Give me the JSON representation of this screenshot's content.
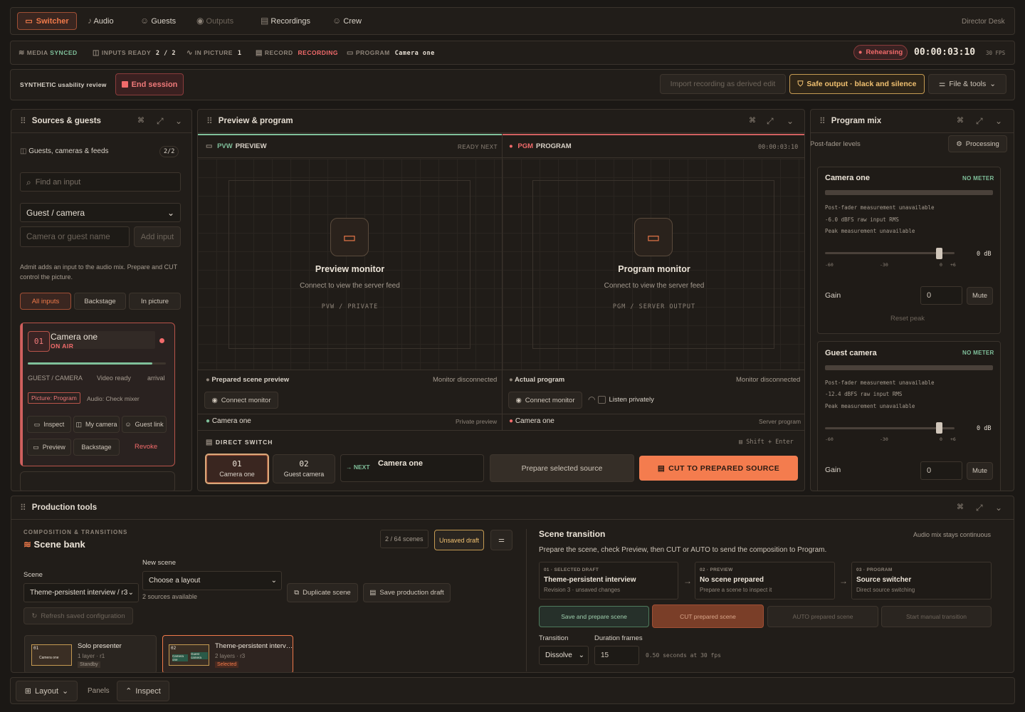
{
  "nav": {
    "tabs": [
      {
        "label": "Switcher",
        "icon": "switcher-icon"
      },
      {
        "label": "Audio",
        "icon": "mic-icon"
      },
      {
        "label": "Guests",
        "icon": "users-icon"
      },
      {
        "label": "Outputs",
        "icon": "broadcast-icon"
      },
      {
        "label": "Recordings",
        "icon": "drive-icon"
      },
      {
        "label": "Crew",
        "icon": "crew-icon"
      }
    ],
    "right": "Director Desk"
  },
  "status": {
    "media_label": "MEDIA",
    "media_value": "SYNCED",
    "inputs_label": "INPUTS READY",
    "inputs_value": "2 / 2",
    "inpicture_label": "IN PICTURE",
    "inpicture_value": "1",
    "record_label": "RECORD",
    "record_value": "RECORDING",
    "program_label": "PROGRAM",
    "program_value": "Camera one",
    "state": "Rehearsing",
    "timecode": "00:00:03:10",
    "fps": "30 FPS"
  },
  "session": {
    "label": "SYNTHETIC usability review",
    "end": "End session",
    "import": "Import recording as derived edit",
    "safe": "Safe output · black and silence",
    "file": "File & tools"
  },
  "sources": {
    "title": "Sources & guests",
    "section": "Guests, cameras & feeds",
    "count": "2/2",
    "search_placeholder": "Find an input",
    "type_select": "Guest / camera",
    "name_placeholder": "Camera or guest name",
    "add": "Add input",
    "help": "Admit adds an input to the audio mix. Prepare and CUT control the picture.",
    "filters": [
      "All inputs",
      "Backstage",
      "In picture"
    ],
    "card": {
      "num": "01",
      "name": "Camera one",
      "state": "ON AIR",
      "kind": "GUEST / CAMERA",
      "video": "Video ready",
      "arrival": "arrival",
      "picture": "Picture: Program",
      "audio": "Audio: Check mixer",
      "inspect": "Inspect",
      "mycam": "My camera",
      "guestlink": "Guest link",
      "preview": "Preview",
      "backstage": "Backstage",
      "revoke": "Revoke"
    }
  },
  "pp": {
    "title": "Preview & program",
    "pvw": {
      "tag": "PVW",
      "label": "PREVIEW",
      "state": "READY NEXT",
      "mon_title": "Preview monitor",
      "mon_sub": "Connect to view the server feed",
      "mon_code": "PVW / PRIVATE",
      "footer_label": "Prepared scene preview",
      "footer_state": "Monitor disconnected",
      "connect": "Connect monitor",
      "source": "Camera one",
      "source_note": "Private preview"
    },
    "pgm": {
      "tag": "PGM",
      "label": "PROGRAM",
      "time": "00:00:03:10",
      "mon_title": "Program monitor",
      "mon_sub": "Connect to view the server feed",
      "mon_code": "PGM / SERVER OUTPUT",
      "footer_label": "Actual program",
      "footer_state": "Monitor disconnected",
      "connect": "Connect monitor",
      "listen": "Listen privately",
      "source": "Camera one",
      "source_note": "Server program"
    },
    "direct": {
      "title": "DIRECT SWITCH",
      "shortcut": "Shift + Enter",
      "s1_num": "01",
      "s1_name": "Camera one",
      "s2_num": "02",
      "s2_name": "Guest camera",
      "next_label": "NEXT",
      "next_value": "Camera one",
      "prepare": "Prepare selected source",
      "cut": "CUT TO PREPARED SOURCE"
    }
  },
  "mix": {
    "title": "Program mix",
    "sub": "Post-fader levels",
    "processing": "Processing",
    "ch": [
      {
        "name": "Camera one",
        "meter": "NO METER",
        "l1": "Post-fader measurement unavailable",
        "l2": "-6.0 dBFS raw input RMS",
        "l3": "Peak measurement unavailable",
        "db": "0 dB",
        "ticks": [
          "-60",
          "-30",
          "0",
          "+6"
        ],
        "gain_label": "Gain",
        "gain": "0",
        "mute": "Mute",
        "reset": "Reset peak"
      },
      {
        "name": "Guest camera",
        "meter": "NO METER",
        "l1": "Post-fader measurement unavailable",
        "l2": "-12.4 dBFS raw input RMS",
        "l3": "Peak measurement unavailable",
        "db": "0 dB",
        "ticks": [
          "-60",
          "-30",
          "0",
          "+6"
        ],
        "gain_label": "Gain",
        "gain": "0",
        "mute": "Mute"
      }
    ]
  },
  "prod": {
    "title": "Production tools",
    "kicker": "COMPOSITION & TRANSITIONS",
    "bank": "Scene bank",
    "scenes": "2 / 64 scenes",
    "draft": "Unsaved draft",
    "new_scene": "New scene",
    "scene_label": "Scene",
    "scene_value": "Theme-persistent interview / r3",
    "layout": "Choose a layout",
    "sources_avail": "2 sources available",
    "dup": "Duplicate scene",
    "save": "Save production draft",
    "refresh": "Refresh saved configuration",
    "tiles": [
      {
        "name": "Solo presenter",
        "meta": "1 layer · r1",
        "badge": "Standby",
        "thumb": "01",
        "thumb2": "Camera one"
      },
      {
        "name": "Theme-persistent interv…",
        "meta": "2 layers · r3",
        "badge": "Selected",
        "thumb": "02",
        "thumb2": "Camera one",
        "thumb3": "Guest camera"
      }
    ],
    "trans": {
      "title": "Scene transition",
      "note": "Audio mix stays continuous",
      "desc": "Prepare the scene, check Preview, then CUT or AUTO to send the composition to Program.",
      "steps": [
        {
          "k": "01 · SELECTED DRAFT",
          "v": "Theme-persistent interview",
          "s": "Revision 3 · unsaved changes"
        },
        {
          "k": "02 · PREVIEW",
          "v": "No scene prepared",
          "s": "Prepare a scene to inspect it"
        },
        {
          "k": "03 · PROGRAM",
          "v": "Source switcher",
          "s": "Direct source switching"
        }
      ],
      "save_prep": "Save and prepare scene",
      "cut": "CUT prepared scene",
      "auto": "AUTO prepared scene",
      "manual": "Start manual transition",
      "t_label": "Transition",
      "t_value": "Dissolve",
      "d_label": "Duration frames",
      "d_value": "15",
      "d_note": "0.50 seconds at 30 fps"
    }
  },
  "bottom": {
    "layout": "Layout",
    "panels": "Panels",
    "inspect": "Inspect"
  },
  "colors": {
    "accent": "#f07a4a",
    "live": "#f26b6b",
    "ok": "#7fbf9a"
  }
}
